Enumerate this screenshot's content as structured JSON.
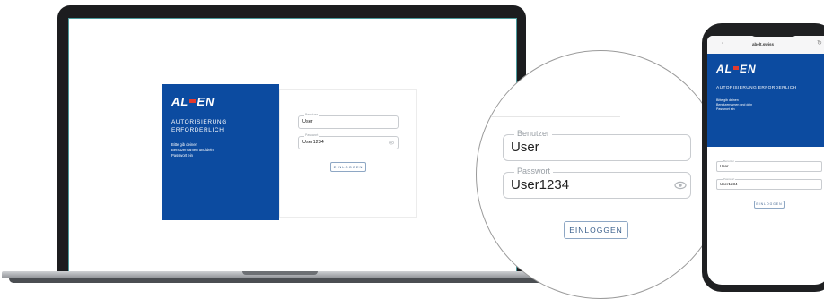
{
  "colors": {
    "brand_blue": "#0c4ba0",
    "logo_accent": "#e33b2e",
    "frame": "#1c1d1f"
  },
  "brand": {
    "logo_left": "AL",
    "logo_right": "EN",
    "heading_line1": "AUTORISIERUNG",
    "heading_line2": "ERFORDERLICH",
    "heading_single": "AUTORISIERUNG ERFORDERLICH",
    "message_line1": "Bitte gib deinen",
    "message_line2": "Benutzernamen und dein",
    "message_line3": "Passwort ein"
  },
  "login": {
    "user_label": "Benutzer",
    "user_value": "User",
    "password_label": "Passwort",
    "password_value": "User1234",
    "submit_label": "EINLOGGEN",
    "eye_icon": "eye-icon"
  },
  "phone": {
    "url": "abelt.swiss"
  }
}
